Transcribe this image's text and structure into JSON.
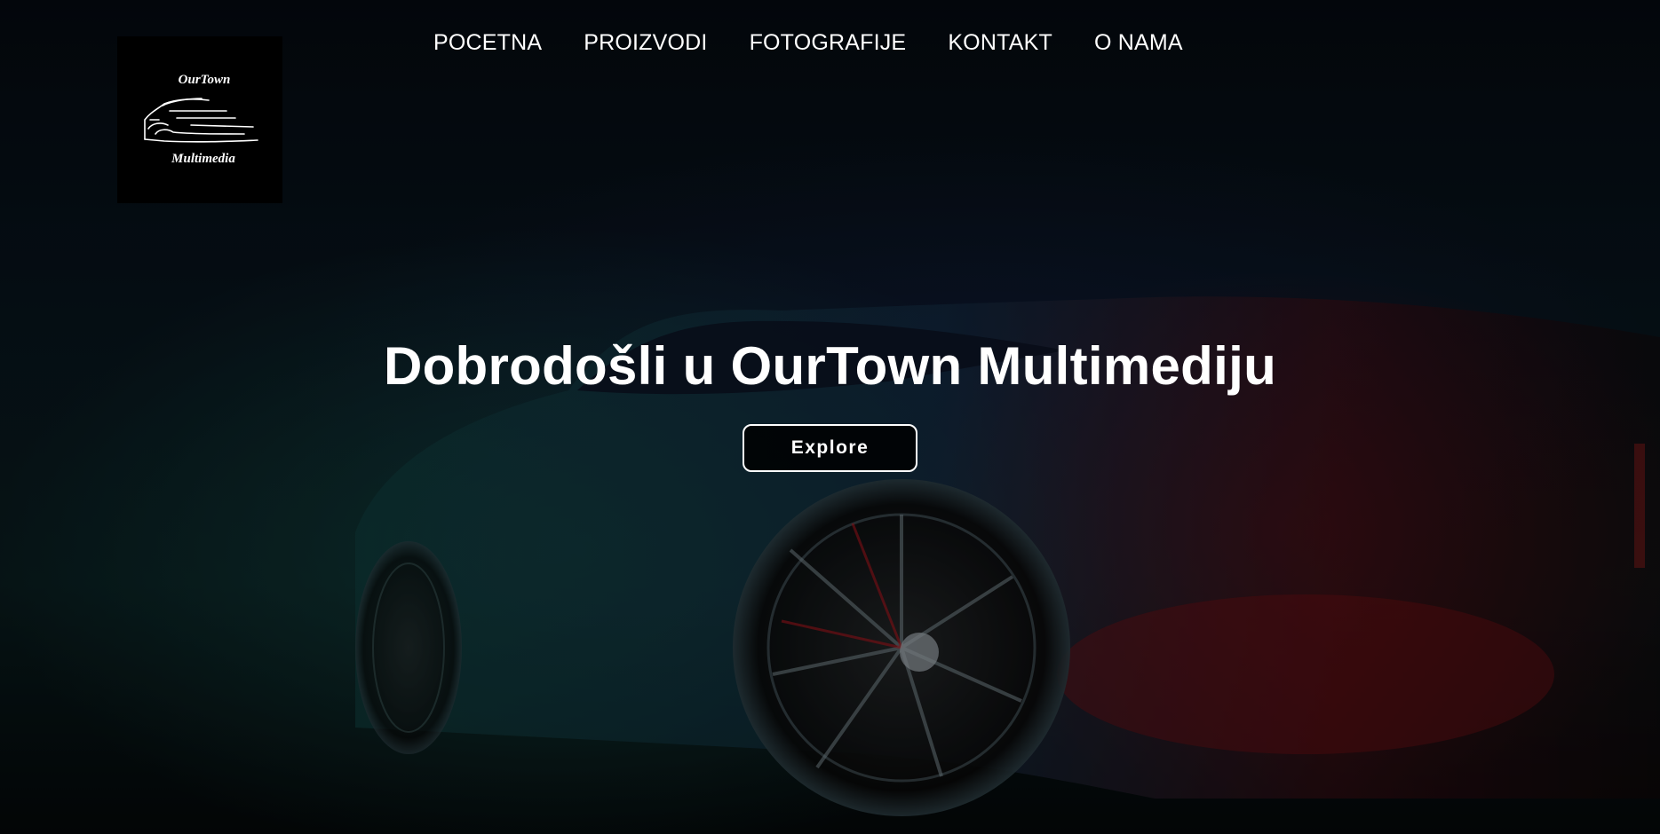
{
  "logo": {
    "top_text": "OurTown",
    "bottom_text": "Multimedia",
    "icon": "car-outline-icon"
  },
  "nav": {
    "items": [
      {
        "label": "POCETNA"
      },
      {
        "label": "PROIZVODI"
      },
      {
        "label": "FOTOGRAFIJE"
      },
      {
        "label": "KONTAKT"
      },
      {
        "label": "O NAMA"
      }
    ]
  },
  "hero": {
    "title": "Dobrodošli u OurTown Multimediju",
    "button_label": "Explore",
    "background": "dark-sports-car-photo"
  },
  "colors": {
    "text": "#ffffff",
    "background": "#05090f",
    "teal_glow": "#164e4a",
    "red_glow": "#5f0a0e"
  }
}
